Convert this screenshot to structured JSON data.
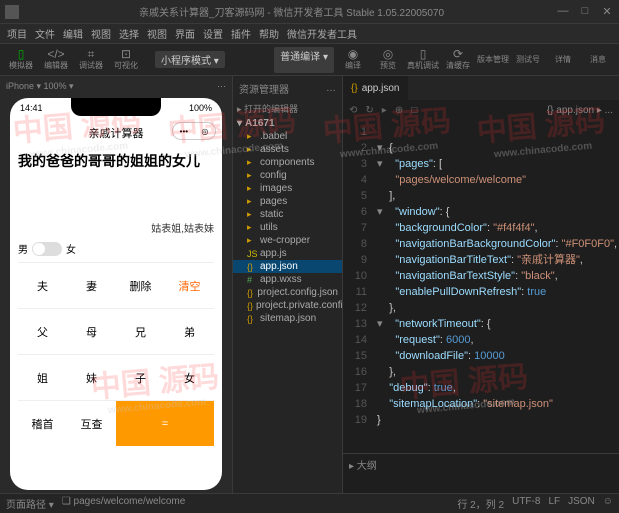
{
  "title_bar": {
    "app_title": "亲戚关系计算器_刀客源码网 - 微信开发者工具 Stable 1.05.22005070"
  },
  "win_controls": {
    "min": "—",
    "max": "□",
    "close": "✕"
  },
  "menu": [
    "项目",
    "文件",
    "编辑",
    "视图",
    "选择",
    "视图",
    "界面",
    "设置",
    "插件",
    "帮助",
    "微信开发者工具"
  ],
  "toolbar": {
    "sim_label": "模拟器",
    "editor_label": "编辑器",
    "debug_label": "调试器",
    "visual_label": "可视化",
    "mode_dropdown": "小程序模式 ▾",
    "compile_label": "普通编译 ▾",
    "compile_btn": "编译",
    "preview_btn": "预览",
    "realdev_btn": "真机调试",
    "cache_btn": "清缓存",
    "right": [
      "版本管理",
      "测试号",
      "详情",
      "消息"
    ]
  },
  "sim": {
    "header_left": "iPhone ▾ 100% ▾",
    "time": "14:41",
    "battery": "100%",
    "app_title": "亲戚计算器",
    "capsule_dots": "•••",
    "capsule_o": "◎",
    "result": "我的爸爸的哥哥的姐姐的女儿",
    "sub": "姑表姐,姑表妹",
    "gender_m": "男",
    "gender_f": "女",
    "cells": [
      "夫",
      "妻",
      "删除",
      "清空",
      "父",
      "母",
      "兄",
      "弟",
      "姐",
      "妹",
      "子",
      "女",
      "稽首",
      "互查",
      "="
    ]
  },
  "explorer": {
    "header": "资源管理器",
    "dots": "…",
    "open_editors": "▸ 打开的编辑器",
    "root": "A1671",
    "items": [
      {
        "name": ".babel",
        "type": "folder"
      },
      {
        "name": "assets",
        "type": "folder"
      },
      {
        "name": "components",
        "type": "folder"
      },
      {
        "name": "config",
        "type": "folder"
      },
      {
        "name": "images",
        "type": "folder"
      },
      {
        "name": "pages",
        "type": "folder"
      },
      {
        "name": "static",
        "type": "folder"
      },
      {
        "name": "utils",
        "type": "folder"
      },
      {
        "name": "we-cropper",
        "type": "folder"
      },
      {
        "name": "app.js",
        "type": "js"
      },
      {
        "name": "app.json",
        "type": "json",
        "sel": true
      },
      {
        "name": "app.wxss",
        "type": "wxss"
      },
      {
        "name": "project.config.json",
        "type": "json"
      },
      {
        "name": "project.private.config.json",
        "type": "json"
      },
      {
        "name": "sitemap.json",
        "type": "json"
      }
    ]
  },
  "editor": {
    "tab": "app.json",
    "crumbs": "{} app.json ▸ ...",
    "icons": [
      "⟲",
      "↻",
      "▸",
      "⊕",
      "□",
      "⚙",
      "⋯"
    ],
    "gutter": [
      "1",
      "2",
      "3",
      "4",
      "5",
      "6",
      "7",
      "8",
      "9",
      "10",
      "11",
      "12",
      "13",
      "14",
      "15",
      "16",
      "17",
      "18",
      "19"
    ],
    "code": {
      "l1_open": "{",
      "l2_k": "\"pages\"",
      "l2_v": ": [",
      "l3": "\"pages/welcome/welcome\"",
      "l4": "],",
      "l5_k": "\"window\"",
      "l5_v": ": {",
      "l6_k": "\"backgroundColor\"",
      "l6_v": "\"#f4f4f4\"",
      "l7_k": "\"navigationBarBackgroundColor\"",
      "l7_v": "\"#F0F0F0\"",
      "l8_k": "\"navigationBarTitleText\"",
      "l8_v": "\"亲戚计算器\"",
      "l9_k": "\"navigationBarTextStyle\"",
      "l9_v": "\"black\"",
      "l10_k": "\"enablePullDownRefresh\"",
      "l10_v": "true",
      "l11": "},",
      "l12_k": "\"networkTimeout\"",
      "l12_v": ": {",
      "l13_k": "\"request\"",
      "l13_v": "6000",
      "l14_k": "\"downloadFile\"",
      "l14_v": "10000",
      "l15": "},",
      "l16_k": "\"debug\"",
      "l16_v": "true",
      "l17_k": "\"sitemapLocation\"",
      "l17_v": "\"sitemap.json\"",
      "l18": "}"
    }
  },
  "terminal": {
    "tabs": [
      "▸ 大纲"
    ]
  },
  "status": {
    "left1": "页面路径 ▾",
    "left2": "❏ pages/welcome/welcome",
    "r1": "行 2，列 2",
    "r2": "UTF-8",
    "r3": "LF",
    "r4": "JSON",
    "r5": "☺"
  },
  "watermark": {
    "cn": "中国 源码",
    "url": "www.chinacode.com"
  }
}
